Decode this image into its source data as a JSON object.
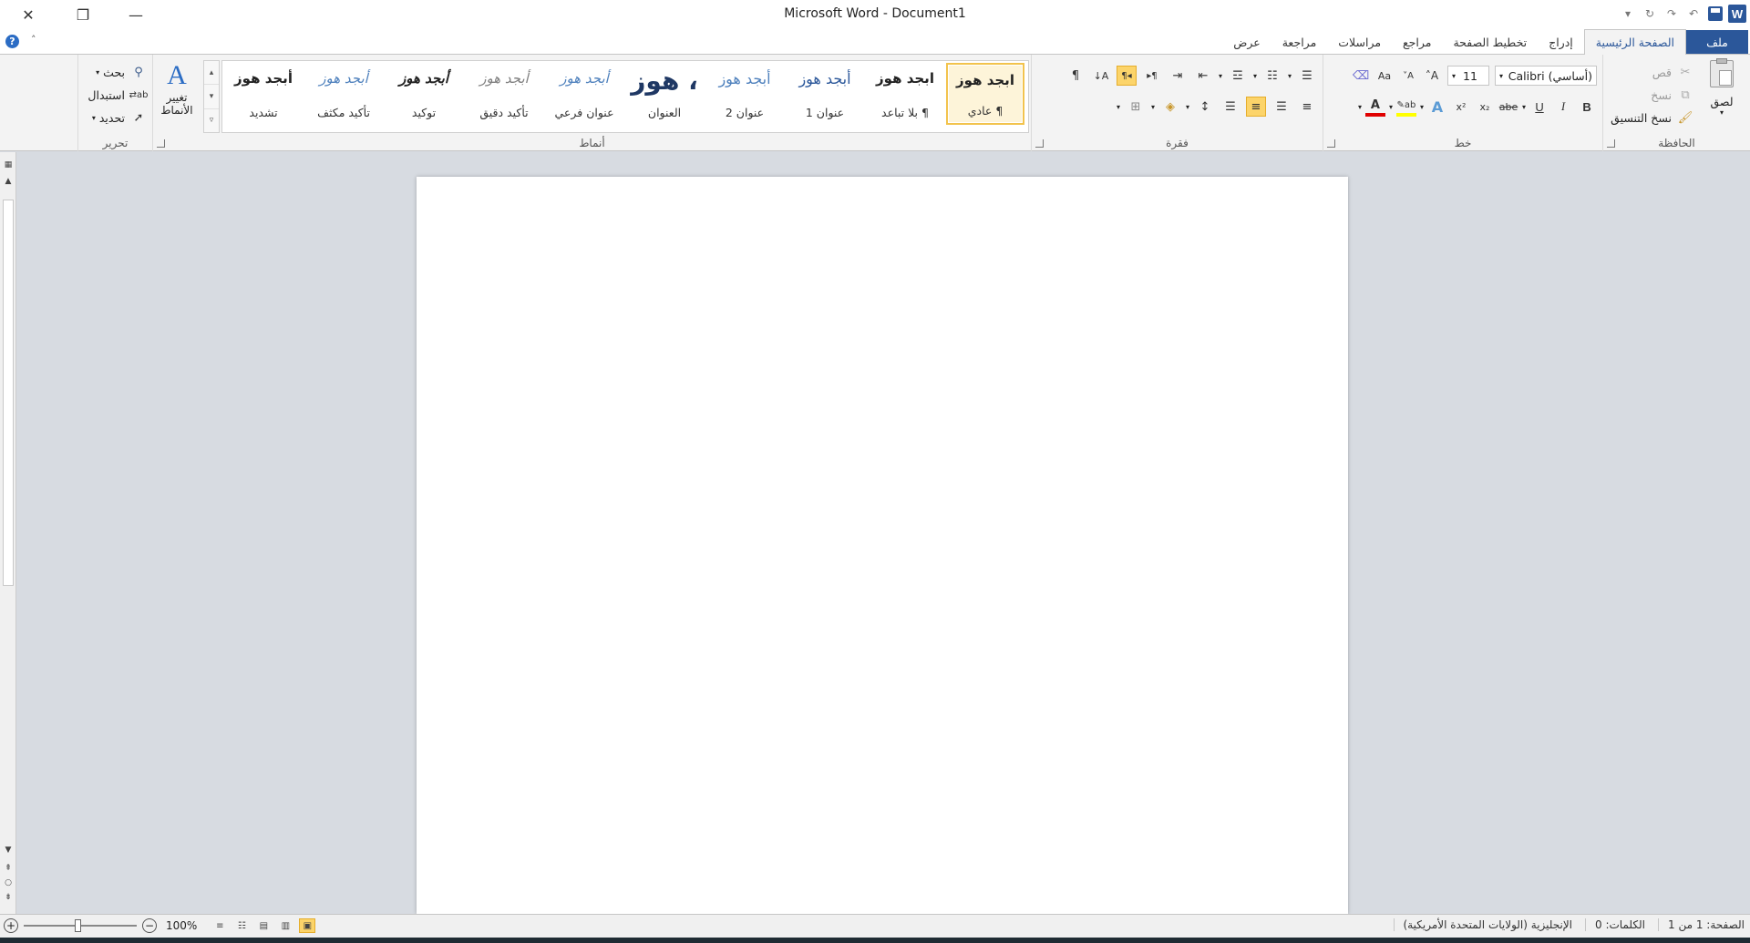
{
  "window": {
    "title": "Microsoft Word  -  Document1",
    "minimize": "—",
    "restore": "❐",
    "close": "✕"
  },
  "qat": {
    "logo": "W",
    "undo": "↶",
    "redo": "↷",
    "repeat": "↻",
    "more": "▾"
  },
  "tabs": [
    {
      "label": "ملف",
      "kind": "file"
    },
    {
      "label": "الصفحة الرئيسية",
      "kind": "active"
    },
    {
      "label": "إدراج"
    },
    {
      "label": "تخطيط الصفحة"
    },
    {
      "label": "مراجع"
    },
    {
      "label": "مراسلات"
    },
    {
      "label": "مراجعة"
    },
    {
      "label": "عرض"
    }
  ],
  "help": "?",
  "clipboard": {
    "label": "الحافظة",
    "paste": "لصق",
    "cut": "قص",
    "copy": "نسخ",
    "format_painter": "نسخ التنسيق"
  },
  "font": {
    "label": "خط",
    "name": "(أساسي) Calibri",
    "size": "11",
    "bold": "B",
    "italic": "I",
    "underline": "U",
    "strike": "abe",
    "sub": "x₂",
    "sup": "x²",
    "grow": "A˄",
    "shrink": "A˅",
    "case": "Aa",
    "font_color": "A"
  },
  "paragraph": {
    "label": "فقرة",
    "pilcrow": "¶"
  },
  "styles": {
    "label": "أنماط",
    "items": [
      {
        "preview": "ابجد هوز",
        "name": "¶ عادي",
        "color": "#222222"
      },
      {
        "preview": "ابجد هوز",
        "name": "¶ بلا تباعد",
        "color": "#222222"
      },
      {
        "preview": "أبجد هوز",
        "name": "عنوان 1",
        "color": "#2b579a"
      },
      {
        "preview": "أبجد هوز",
        "name": "عنوان 2",
        "color": "#4f81bd"
      },
      {
        "preview": "، هوز",
        "name": "العنوان",
        "color": "#1f3864"
      },
      {
        "preview": "أبجد هوز",
        "name": "عنوان فرعي",
        "color": "#4f81bd"
      },
      {
        "preview": "أبجد هوز",
        "name": "تأكيد دقيق",
        "color": "#7f7f7f"
      },
      {
        "preview": "أبجد هوز",
        "name": "توكيد",
        "color": "#222222"
      },
      {
        "preview": "أبجد هوز",
        "name": "تأكيد مكثف",
        "color": "#4f81bd"
      },
      {
        "preview": "أبجد هوز",
        "name": "تشديد",
        "color": "#222222"
      }
    ],
    "change": "تغيير الأنماط"
  },
  "editing": {
    "label": "تحرير",
    "find": "بحث",
    "replace": "استبدال",
    "select": "تحديد"
  },
  "status": {
    "page": "الصفحة: 1 من 1",
    "words": "الكلمات: 0",
    "language": "الإنجليزية (الولايات المتحدة الأمريكية)",
    "zoom": "100%"
  }
}
